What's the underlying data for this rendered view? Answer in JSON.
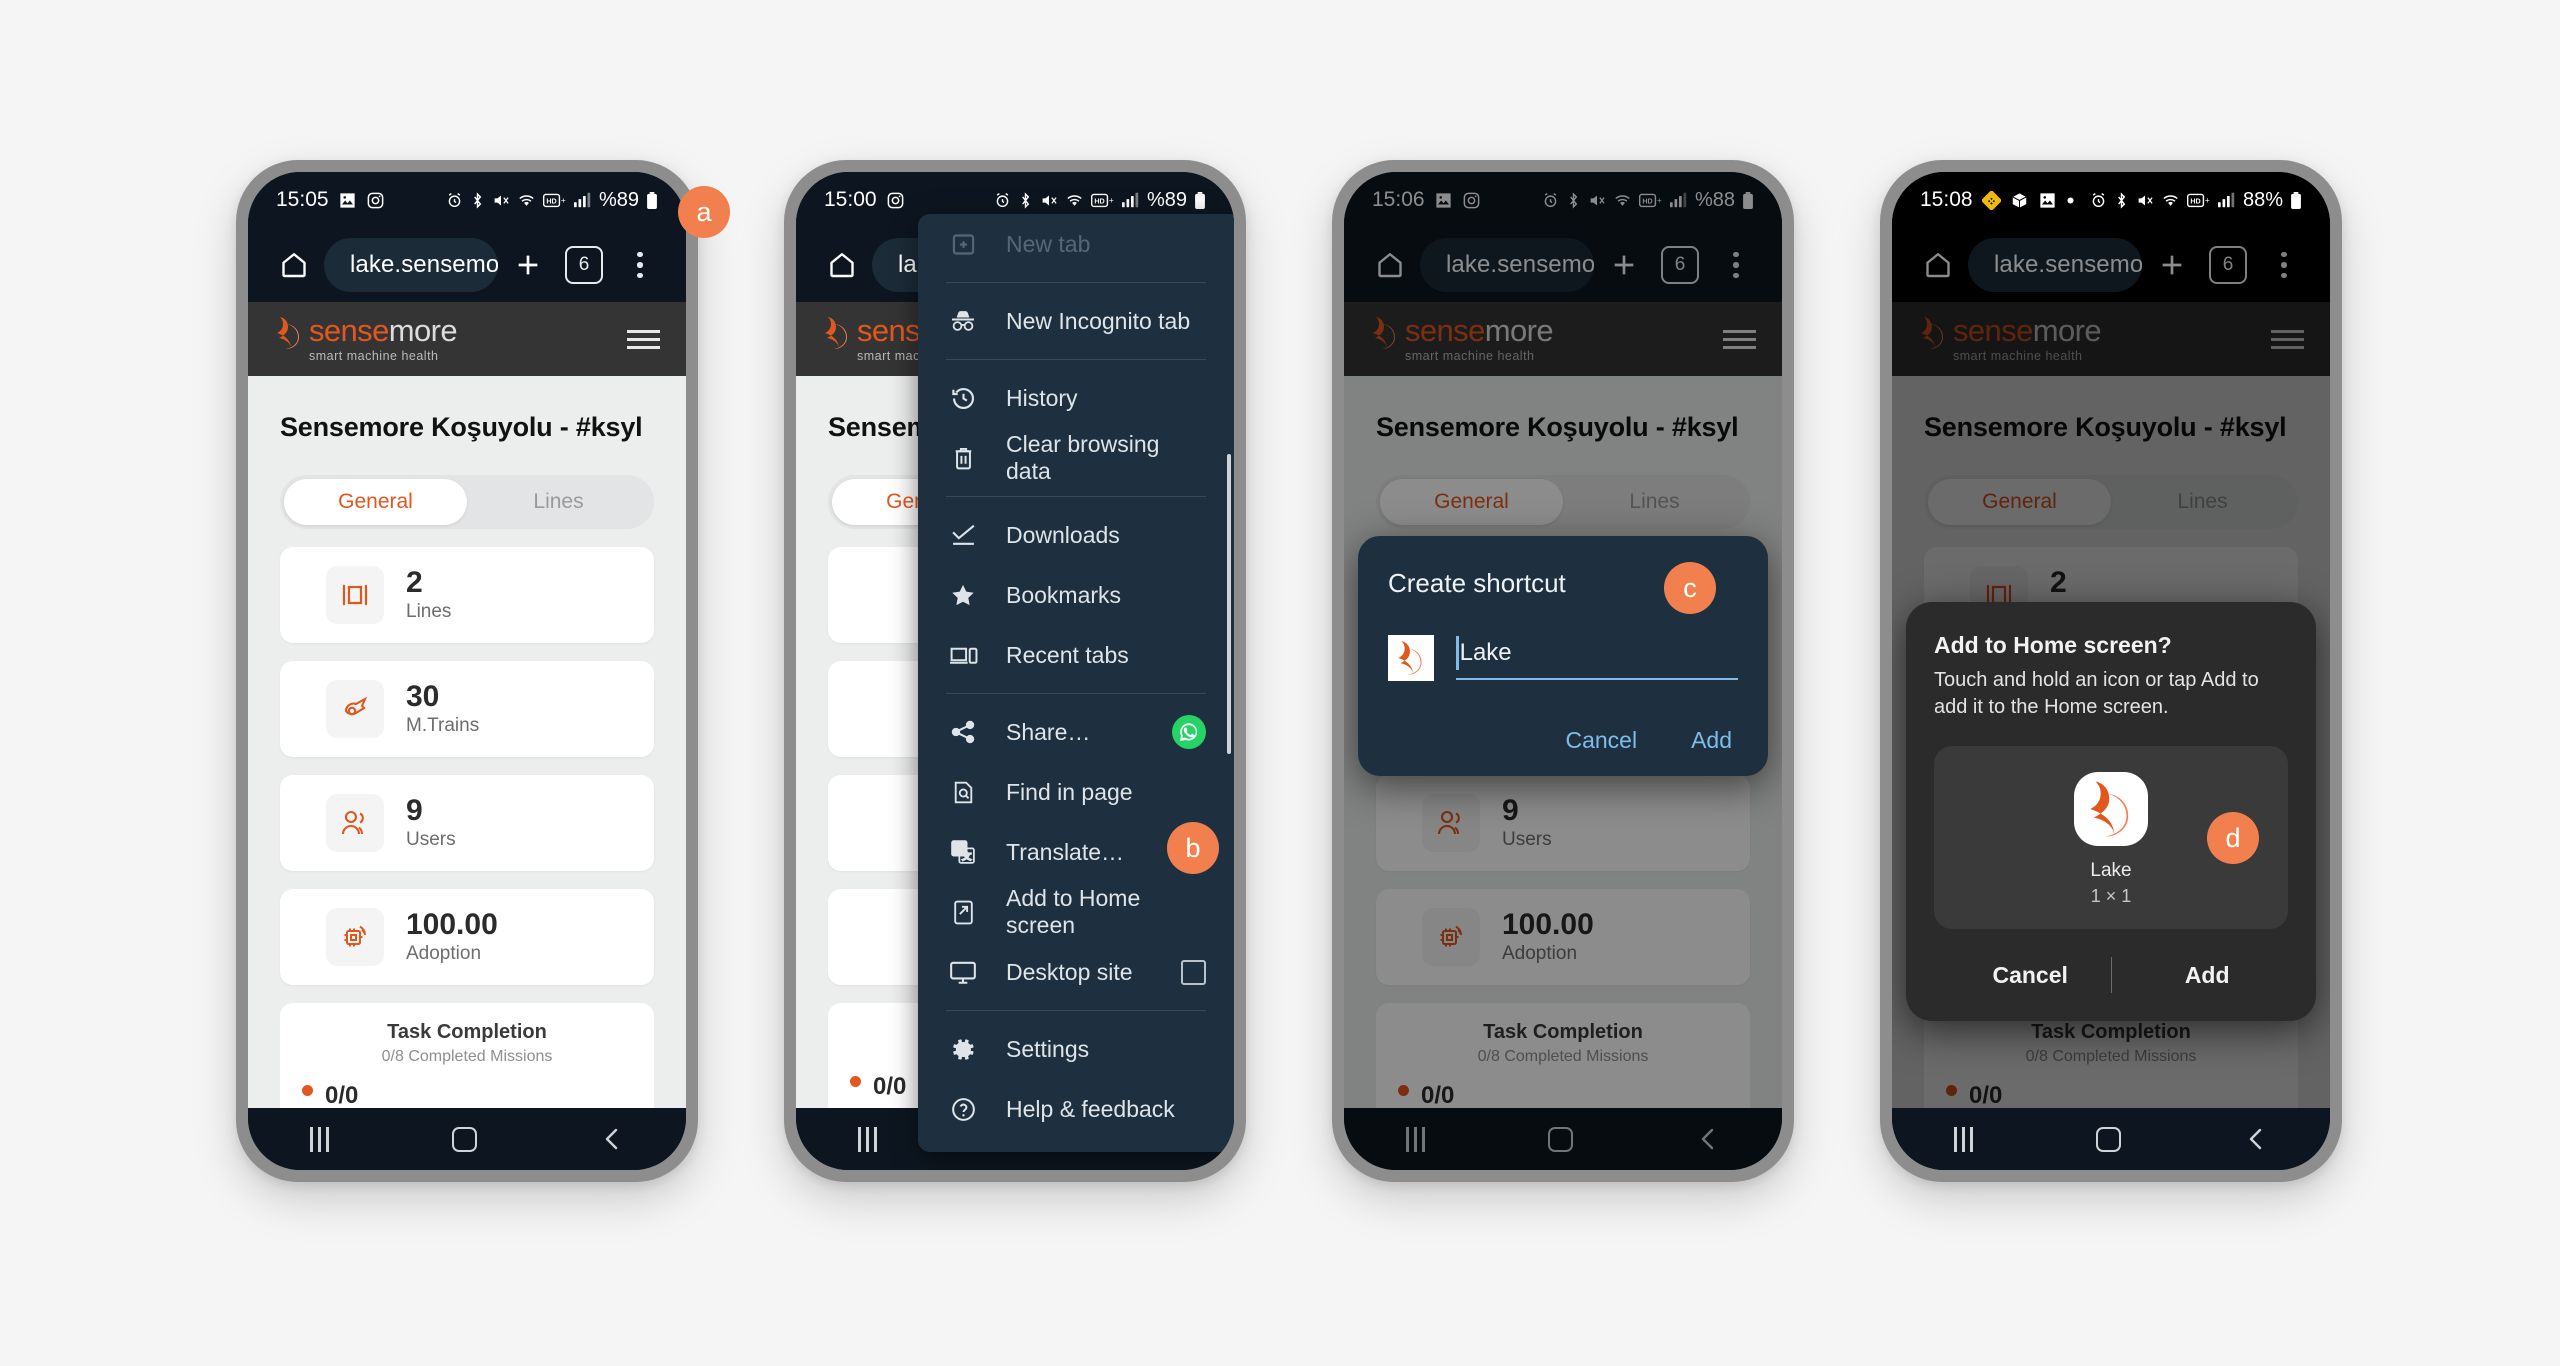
{
  "web": {
    "logo_main_a": "sense",
    "logo_main_b": "more",
    "logo_sub": "smart machine health",
    "page_title": "Sensemore Koşuyolu - #ksyl",
    "tabs": [
      {
        "label": "General",
        "active": true
      },
      {
        "label": "Lines",
        "active": false
      }
    ],
    "cards": [
      {
        "icon": "lines-icon",
        "value": "2",
        "label": "Lines"
      },
      {
        "icon": "sensor-icon",
        "value": "30",
        "label": "M.Trains"
      },
      {
        "icon": "users-icon",
        "value": "9",
        "label": "Users"
      },
      {
        "icon": "adoption-icon",
        "value": "100.00",
        "label": "Adoption"
      }
    ],
    "task": {
      "title": "Task Completion",
      "subtitle": "0/8 Completed Missions",
      "value": "0/0"
    }
  },
  "browser": {
    "url": "lake.sensemore.io",
    "tab_count": "6",
    "new_tab_label": "+",
    "home_label": "home-button"
  },
  "phones": [
    {
      "id": "a",
      "badge": "a",
      "status": {
        "time": "15:05",
        "left_icons": [
          "photo-icon",
          "instagram-icon"
        ],
        "battery": "%89"
      }
    },
    {
      "id": "b",
      "badge": "b",
      "status": {
        "time": "15:00",
        "left_icons": [
          "instagram-icon"
        ],
        "battery": "%89"
      },
      "url_clipped": "lake."
    },
    {
      "id": "c",
      "badge": "c",
      "status": {
        "time": "15:06",
        "left_icons": [
          "photo-icon",
          "instagram-icon"
        ],
        "battery": "%88"
      }
    },
    {
      "id": "d",
      "badge": "d",
      "status": {
        "time": "15:08",
        "left_icons": [
          "binance-icon",
          "package-icon",
          "photo-icon",
          "dot-icon"
        ],
        "battery": "88%"
      }
    }
  ],
  "menu": {
    "items": [
      {
        "label": "New tab",
        "icon": "new-tab-icon",
        "faded": true,
        "sep_after": true
      },
      {
        "label": "New Incognito tab",
        "icon": "incognito-icon",
        "faded": false,
        "sep_after": true
      },
      {
        "label": "History",
        "icon": "history-icon",
        "faded": false,
        "sep_after": false
      },
      {
        "label": "Clear browsing data",
        "icon": "trash-icon",
        "faded": false,
        "sep_after": true
      },
      {
        "label": "Downloads",
        "icon": "download-icon",
        "faded": false,
        "sep_after": false
      },
      {
        "label": "Bookmarks",
        "icon": "star-icon",
        "faded": false,
        "sep_after": false
      },
      {
        "label": "Recent tabs",
        "icon": "recent-tabs-icon",
        "faded": false,
        "sep_after": true
      },
      {
        "label": "Share…",
        "icon": "share-icon",
        "faded": false,
        "sep_after": false,
        "trailing": "whatsapp-icon"
      },
      {
        "label": "Find in page",
        "icon": "find-in-page-icon",
        "faded": false,
        "sep_after": false
      },
      {
        "label": "Translate…",
        "icon": "translate-icon",
        "faded": false,
        "sep_after": false
      },
      {
        "label": "Add to Home screen",
        "icon": "add-to-home-icon",
        "faded": false,
        "sep_after": false
      },
      {
        "label": "Desktop site",
        "icon": "desktop-site-icon",
        "faded": false,
        "sep_after": true,
        "trailing": "checkbox"
      },
      {
        "label": "Settings",
        "icon": "settings-gear-icon",
        "faded": false,
        "sep_after": false
      },
      {
        "label": "Help & feedback",
        "icon": "help-icon",
        "faded": false,
        "sep_after": false
      }
    ]
  },
  "create_shortcut": {
    "title": "Create shortcut",
    "value": "Lake",
    "cancel": "Cancel",
    "add": "Add"
  },
  "add_to_home": {
    "title": "Add to Home screen?",
    "description": "Touch and hold an icon or tap Add to add it to the Home screen.",
    "item_name": "Lake",
    "item_size": "1 × 1",
    "cancel": "Cancel",
    "add": "Add"
  },
  "colors": {
    "accent": "#e2571e",
    "badge": "#f2804f",
    "menu_bg": "#1e3040",
    "dialog_link": "#7fbde8",
    "whatsapp": "#25d366"
  }
}
